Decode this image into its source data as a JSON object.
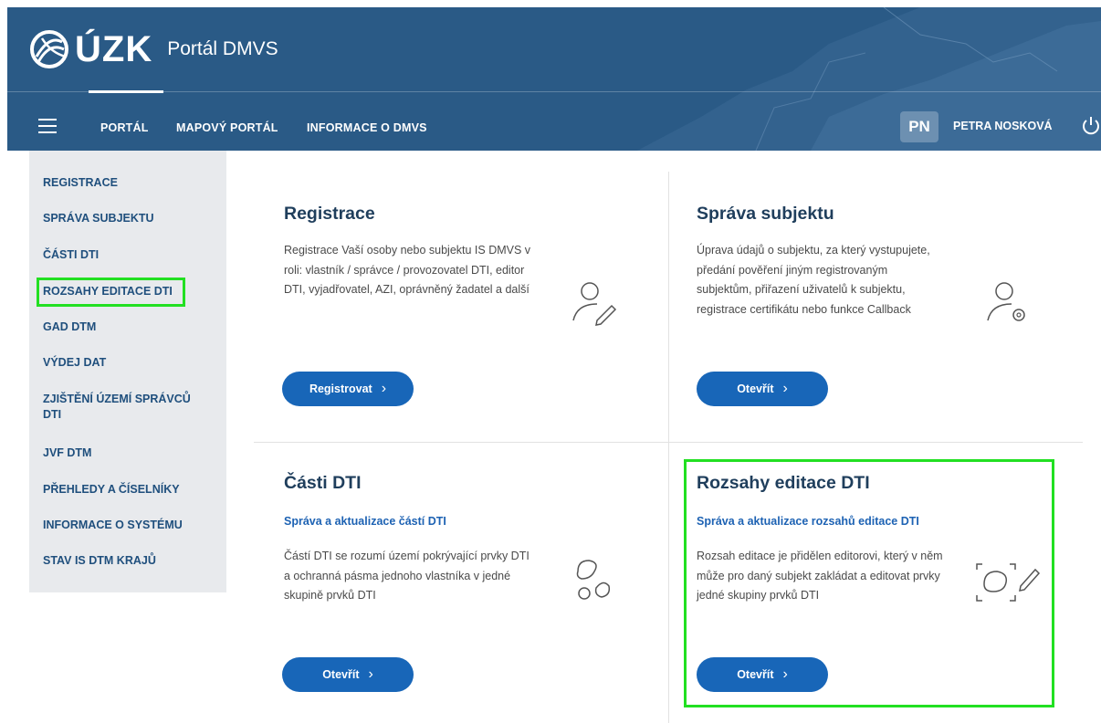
{
  "header": {
    "logo_text": "ÚZK",
    "portal_title": "Portál DMVS",
    "nav": [
      "PORTÁL",
      "MAPOVÝ PORTÁL",
      "INFORMACE O DMVS"
    ],
    "user": {
      "initials": "PN",
      "name": "PETRA NOSKOVÁ"
    },
    "bg_color": "#2a5a86"
  },
  "sidebar": {
    "items": [
      "REGISTRACE",
      "SPRÁVA SUBJEKTU",
      "ČÁSTI DTI",
      "ROZSAHY EDITACE DTI",
      "GAD DTM",
      "VÝDEJ DAT",
      "ZJIŠTĚNÍ ÚZEMÍ SPRÁVCŮ DTI",
      "JVF DTM",
      "PŘEHLEDY A ČÍSELNÍKY",
      "INFORMACE O SYSTÉMU",
      "STAV IS DTM KRAJŮ"
    ],
    "highlighted": "ROZSAHY EDITACE DTI"
  },
  "cards": [
    {
      "title": "Registrace",
      "description": "Registrace Vaší osoby nebo subjektu IS DMVS v roli: vlastník / správce / provozovatel DTI, editor DTI, vyjadřovatel, AZI, oprávněný žadatel a další",
      "button": "Registrovat",
      "icon": "user-edit-icon"
    },
    {
      "title": "Správa subjektu",
      "description": "Úprava údajů o subjektu, za který vystupujete, předání pověření jiným registrovaným subjektům, přiřazení uživatelů k subjektu, registrace certifikátu nebo funkce Callback",
      "button": "Otevřít",
      "icon": "user-settings-icon"
    },
    {
      "title": "Části DTI",
      "subtitle": "Správa a aktualizace částí DTI",
      "description": "Částí DTI se rozumí území pokrývající prvky DTI a ochranná pásma jednoho vlastníka v jedné skupině prvků DTI",
      "button": "Otevřít",
      "icon": "shapes-icon"
    },
    {
      "title": "Rozsahy editace DTI",
      "subtitle": "Správa a aktualizace rozsahů editace DTI",
      "description": "Rozsah editace je přidělen editorovi, který v něm může pro daný subjekt zakládat a editovat prvky jedné skupiny prvků DTI",
      "button": "Otevřít",
      "icon": "area-edit-icon"
    }
  ],
  "colors": {
    "accent": "#1866b8",
    "highlight": "#22e022",
    "title": "#1f3e5c"
  }
}
